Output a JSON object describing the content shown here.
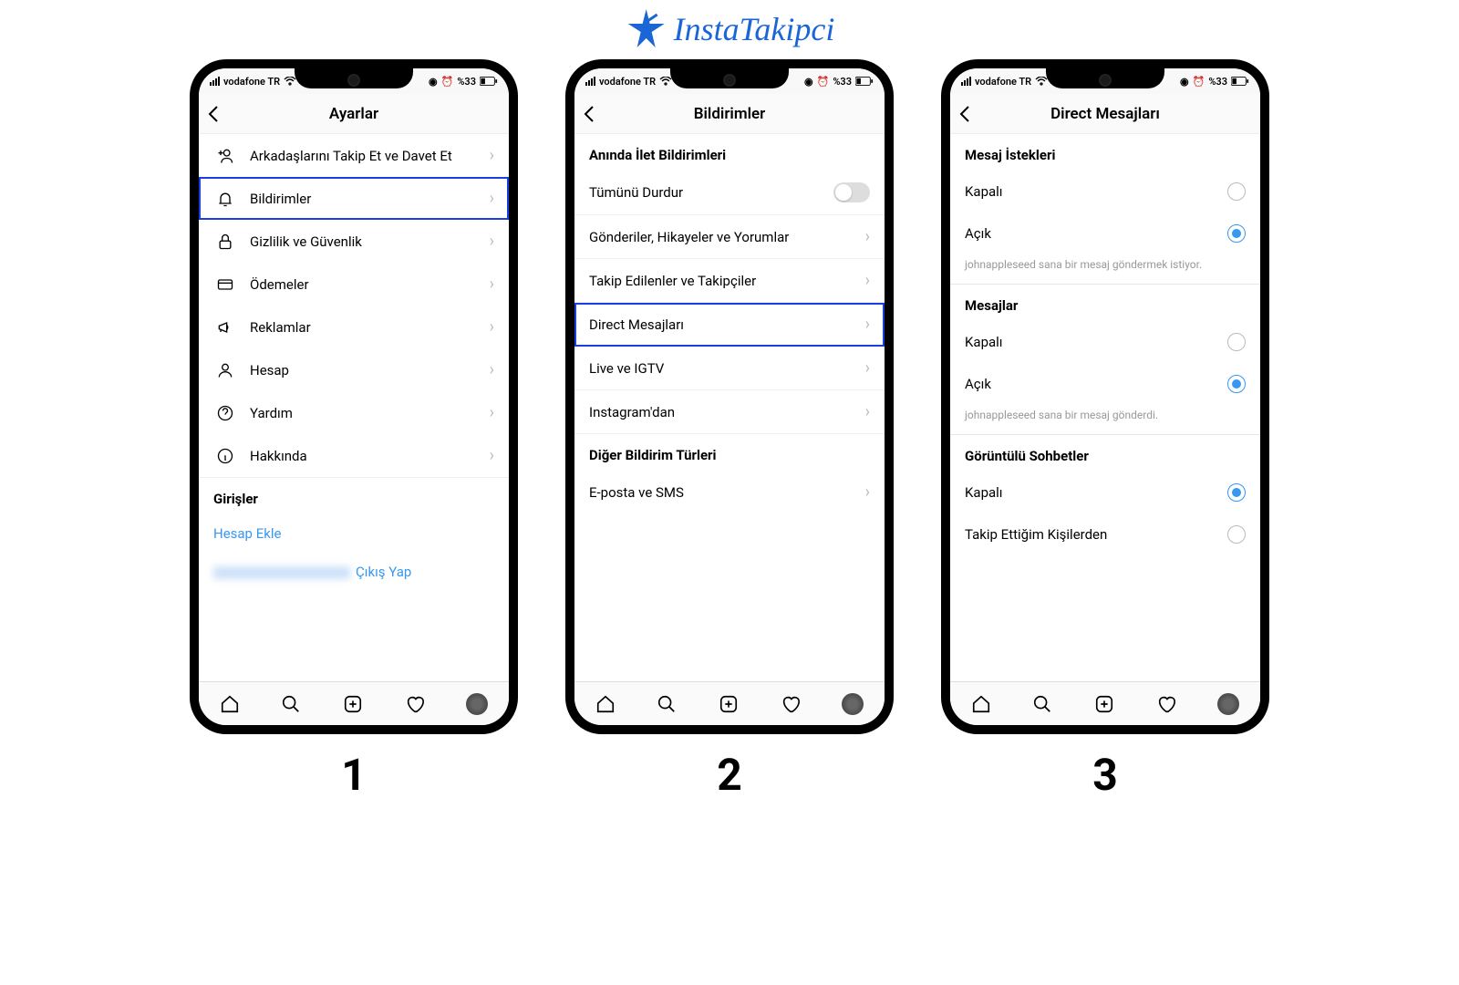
{
  "brand": {
    "name": "InstaTakipci"
  },
  "status": {
    "carrier": "vodafone TR",
    "battery": "%33"
  },
  "bottomNav": [
    "home",
    "search",
    "add",
    "activity",
    "profile"
  ],
  "phone1": {
    "title": "Ayarlar",
    "items": [
      {
        "icon": "user-plus",
        "label": "Arkadaşlarını Takip Et ve Davet Et"
      },
      {
        "icon": "bell",
        "label": "Bildirimler",
        "highlight": true
      },
      {
        "icon": "lock",
        "label": "Gizlilik ve Güvenlik"
      },
      {
        "icon": "card",
        "label": "Ödemeler"
      },
      {
        "icon": "megaphone",
        "label": "Reklamlar"
      },
      {
        "icon": "person",
        "label": "Hesap"
      },
      {
        "icon": "help",
        "label": "Yardım"
      },
      {
        "icon": "info",
        "label": "Hakkında"
      }
    ],
    "loginsHeader": "Girişler",
    "addAccount": "Hesap Ekle",
    "logout": "Çıkış Yap",
    "step": "1"
  },
  "phone2": {
    "title": "Bildirimler",
    "pushHeader": "Anında İlet Bildirimleri",
    "pauseAll": "Tümünü Durdur",
    "items": [
      {
        "label": "Gönderiler, Hikayeler ve Yorumlar"
      },
      {
        "label": "Takip Edilenler ve Takipçiler"
      },
      {
        "label": "Direct Mesajları",
        "highlight": true
      },
      {
        "label": "Live ve IGTV"
      },
      {
        "label": "Instagram'dan"
      }
    ],
    "otherHeader": "Diğer Bildirim Türleri",
    "otherItem": "E-posta ve SMS",
    "step": "2"
  },
  "phone3": {
    "title": "Direct Mesajları",
    "sec1": {
      "header": "Mesaj İstekleri",
      "off": "Kapalı",
      "on": "Açık",
      "helper": "johnappleseed sana bir mesaj göndermek istiyor."
    },
    "sec2": {
      "header": "Mesajlar",
      "off": "Kapalı",
      "on": "Açık",
      "helper": "johnappleseed sana bir mesaj gönderdi."
    },
    "sec3": {
      "header": "Görüntülü Sohbetler",
      "off": "Kapalı",
      "follow": "Takip Ettiğim Kişilerden"
    },
    "step": "3"
  }
}
